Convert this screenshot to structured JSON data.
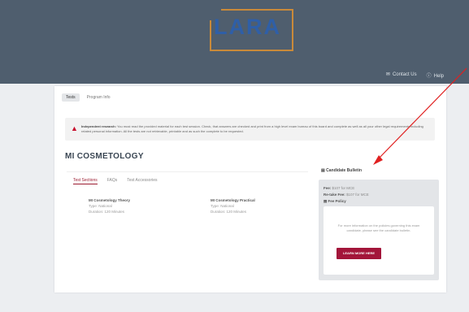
{
  "header": {
    "logo_text": "LARA",
    "contact_label": "Contact Us",
    "help_label": "Help"
  },
  "tabs": [
    "Tests",
    "Program Info"
  ],
  "alert": {
    "bold": "Independent research:",
    "text": "You must read the provided material for each test session. Check, that answers are checked and print from a high level exam bureau of this board and complete as well as all your other legal requirements including related personal information. All the tests are not retrievable, printable and as such the complete to be requested."
  },
  "title": "MI COSMETOLOGY",
  "subtabs": [
    "Test Sections",
    "FAQs",
    "Test Accessories"
  ],
  "tests": [
    {
      "name": "MI Cosmetology Theory",
      "line1": "Type: National",
      "line2": "Duration: 120 Minutes"
    },
    {
      "name": "MI Cosmetology Practical",
      "line1": "Type: National",
      "line2": "Duration: 120 Minutes"
    }
  ],
  "candidate": {
    "heading": "Candidate Bulletin",
    "fee_label": "Fee:",
    "fee_value": "$107 for MCE",
    "reexam_label": "Re-take Fee:",
    "reexam_value": "$107 for MCE",
    "policy_link": "Fee Policy",
    "message": "For more information on the policies governing this exam candidate, please see the candidate bulletin.",
    "button": "LEARN MORE HERE"
  },
  "colors": {
    "header_bg": "#4f5e6e",
    "logo_blue": "#2f5fa7",
    "logo_frame": "#c98a3a",
    "accent": "#a3153a",
    "arrow": "#e02020"
  }
}
